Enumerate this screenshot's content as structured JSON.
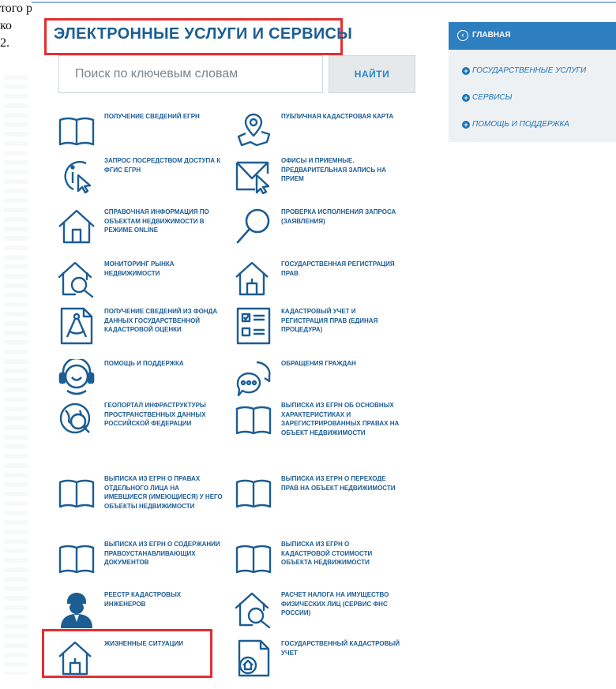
{
  "background_text": [
    "того разделе в поле",
    "ко",
    "2."
  ],
  "header": {
    "title": "ЭЛЕКТРОННЫЕ УСЛУГИ И СЕРВИСЫ"
  },
  "search": {
    "placeholder": "Поиск по ключевым словам",
    "button_label": "НАЙТИ"
  },
  "colors": {
    "accent": "#2e7fc0",
    "label": "#1c5d94",
    "highlight": "#e32f30",
    "nav_bg": "#eef1f4"
  },
  "services": [
    {
      "label": "ПОЛУЧЕНИЕ СВЕДЕНИЙ ЕГРН",
      "icon": "book-icon"
    },
    {
      "label": "ПУБЛИЧНАЯ КАДАСТРОВАЯ КАРТА",
      "icon": "map-pin-icon"
    },
    {
      "label": "ЗАПРОС ПОСРЕДСТВОМ ДОСТУПА К ФГИС ЕГРН",
      "icon": "info-cursor-icon"
    },
    {
      "label": "ОФИСЫ И ПРИЕМНЫЕ. ПРЕДВАРИТЕЛЬНАЯ ЗАПИСЬ НА ПРИЕМ",
      "icon": "envelope-cursor-icon"
    },
    {
      "label": "СПРАВОЧНАЯ ИНФОРМАЦИЯ ПО ОБЪЕКТАМ НЕДВИЖИМОСТИ В РЕЖИМЕ ONLINE",
      "icon": "house-icon"
    },
    {
      "label": "ПРОВЕРКА ИСПОЛНЕНИЯ ЗАПРОСА (ЗАЯВЛЕНИЯ)",
      "icon": "magnifier-icon"
    },
    {
      "label": "МОНИТОРИНГ РЫНКА НЕДВИЖИМОСТИ",
      "icon": "house-magnifier-icon"
    },
    {
      "label": "ГОСУДАРСТВЕННАЯ РЕГИСТРАЦИЯ ПРАВ",
      "icon": "house-document-icon"
    },
    {
      "label": "ПОЛУЧЕНИЕ СВЕДЕНИЙ ИЗ ФОНДА ДАННЫХ ГОСУДАРСТВЕННОЙ КАДАСТРОВОЙ ОЦЕНКИ",
      "icon": "compass-document-icon"
    },
    {
      "label": "КАДАСТРОВЫЙ УЧЕТ И РЕГИСТРАЦИЯ ПРАВ (ЕДИНАЯ ПРОЦЕДУРА)",
      "icon": "checklist-icon"
    },
    {
      "label": "ПОМОЩЬ И ПОДДЕРЖКА",
      "icon": "support-headset-icon"
    },
    {
      "label": "ОБРАЩЕНИЯ ГРАЖДАН",
      "icon": "chat-bubble-icon"
    },
    {
      "label": "ГЕОПОРТАЛ ИНФРАСТРУКТУРЫ ПРОСТРАНСТВЕННЫХ ДАННЫХ РОССИЙСКОЙ ФЕДЕРАЦИИ",
      "icon": "globe-icon"
    },
    {
      "label": "ВЫПИСКА ИЗ ЕГРН ОБ ОСНОВНЫХ ХАРАКТЕРИСТИКАХ И ЗАРЕГИСТРИРОВАННЫХ ПРАВАХ НА ОБЪЕКТ НЕДВИЖИМОСТИ",
      "icon": "book-icon"
    },
    {
      "label": "ВЫПИСКА ИЗ ЕГРН О ПРАВАХ ОТДЕЛЬНОГО ЛИЦА НА ИМЕВШИЕСЯ (ИМЕЮЩИЕСЯ) У НЕГО ОБЪЕКТЫ НЕДВИЖИМОСТИ",
      "icon": "book-icon"
    },
    {
      "label": "ВЫПИСКА ИЗ ЕГРН О ПЕРЕХОДЕ ПРАВ НА ОБЪЕКТ НЕДВИЖИМОСТИ",
      "icon": "book-icon"
    },
    {
      "label": "ВЫПИСКА ИЗ ЕГРН О СОДЕРЖАНИИ ПРАВОУСТАНАВЛИВАЮЩИХ ДОКУМЕНТОВ",
      "icon": "book-icon"
    },
    {
      "label": "ВЫПИСКА ИЗ ЕГРН О КАДАСТРОВОЙ СТОИМОСТИ ОБЪЕКТА НЕДВИЖИМОСТИ",
      "icon": "book-icon"
    },
    {
      "label": "РЕЕСТР КАДАСТРОВЫХ ИНЖЕНЕРОВ",
      "icon": "engineer-icon"
    },
    {
      "label": "РАСЧЕТ НАЛОГА НА ИМУЩЕСТВО ФИЗИЧЕСКИХ ЛИЦ (СЕРВИС ФНС РОССИИ)",
      "icon": "house-magnifier-icon"
    },
    {
      "label": "ЖИЗНЕННЫЕ СИТУАЦИИ",
      "icon": "house-document-icon"
    },
    {
      "label": "ГОСУДАРСТВЕННЫЙ КАДАСТРОВЫЙ УЧЕТ",
      "icon": "document-house-icon"
    }
  ],
  "nav": {
    "main_label": "ГЛАВНАЯ",
    "main_icon": "circle-arrow-left-icon",
    "items": [
      {
        "label": "ГОСУДАРСТВЕННЫЕ УСЛУГИ",
        "icon": "plus-circle-icon"
      },
      {
        "label": "СЕРВИСЫ",
        "icon": "plus-circle-icon"
      },
      {
        "label": "ПОМОЩЬ И ПОДДЕРЖКА",
        "icon": "plus-circle-icon"
      }
    ]
  }
}
